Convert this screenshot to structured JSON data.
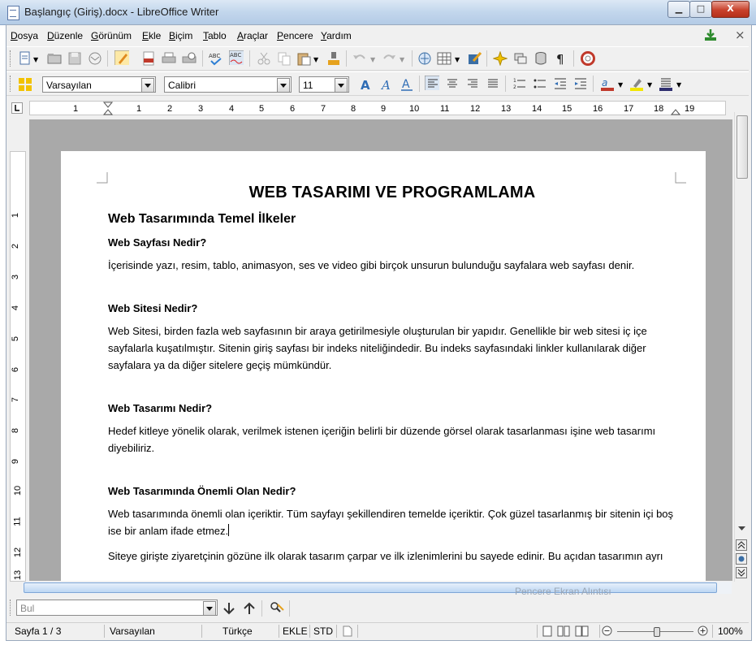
{
  "window": {
    "title": "Başlangıç (Giriş).docx - LibreOffice Writer",
    "minimize_glyph": "▁",
    "maximize_glyph": "□",
    "close_glyph": "X"
  },
  "menu": {
    "items": [
      "Dosya",
      "Düzenle",
      "Görünüm",
      "Ekle",
      "Biçim",
      "Tablo",
      "Araçlar",
      "Pencere",
      "Yardım"
    ],
    "close_doc_glyph": "×"
  },
  "formatting": {
    "paragraph_style": "Varsayılan",
    "font_name": "Calibri",
    "font_size": "11"
  },
  "ruler": {
    "ticks": [
      "1",
      "1",
      "2",
      "3",
      "4",
      "5",
      "6",
      "7",
      "8",
      "9",
      "10",
      "11",
      "12",
      "13",
      "14",
      "15",
      "16",
      "17",
      "18",
      "19"
    ],
    "vticks": [
      "1",
      "2",
      "3",
      "4",
      "5",
      "6",
      "7",
      "8",
      "9",
      "10",
      "11",
      "12",
      "13"
    ]
  },
  "document": {
    "title": "WEB TASARIMI VE PROGRAMLAMA",
    "heading1": "Web Tasarımında Temel İlkeler",
    "sections": [
      {
        "heading": "Web Sayfası Nedir?",
        "body": "İçerisinde yazı, resim, tablo, animasyon, ses ve video gibi birçok unsurun bulunduğu sayfalara web sayfası denir."
      },
      {
        "heading": "Web Sitesi Nedir?",
        "body": "Web Sitesi, birden fazla web sayfasının bir araya getirilmesiyle oluşturulan bir yapıdır. Genellikle bir web sitesi iç içe sayfalarla kuşatılmıştır. Sitenin giriş sayfası bir indeks niteliğindedir. Bu indeks sayfasındaki linkler kullanılarak diğer sayfalara ya da diğer sitelere geçiş mümkündür."
      },
      {
        "heading": "Web Tasarımı Nedir?",
        "body": "Hedef kitleye yönelik olarak, verilmek istenen içeriğin belirli bir düzende görsel olarak tasarlanması işine web tasarımı diyebiliriz."
      },
      {
        "heading": "Web Tasarımında Önemli Olan Nedir?",
        "body": "Web tasarımında önemli olan içeriktir. Tüm sayfayı şekillendiren temelde içeriktir. Çok güzel tasarlanmış bir sitenin içi boş ise bir anlam ifade etmez."
      }
    ],
    "trailing_line": "Siteye girişte ziyaretçinin gözüne ilk olarak tasarım çarpar ve ilk izlenimlerini bu sayede edinir. Bu açıdan tasarımın ayrı"
  },
  "find": {
    "placeholder": "Bul"
  },
  "status": {
    "page": "Sayfa 1 / 3",
    "style": "Varsayılan",
    "language": "Türkçe",
    "insert_mode": "EKLE",
    "selection_mode": "STD",
    "zoom": "100%"
  },
  "watermark": "Pencere Ekran Alıntısı",
  "colors": {
    "accent_blue": "#2f6db5",
    "page_bg": "#ffffff",
    "canvas_bg": "#a9a9a9"
  }
}
